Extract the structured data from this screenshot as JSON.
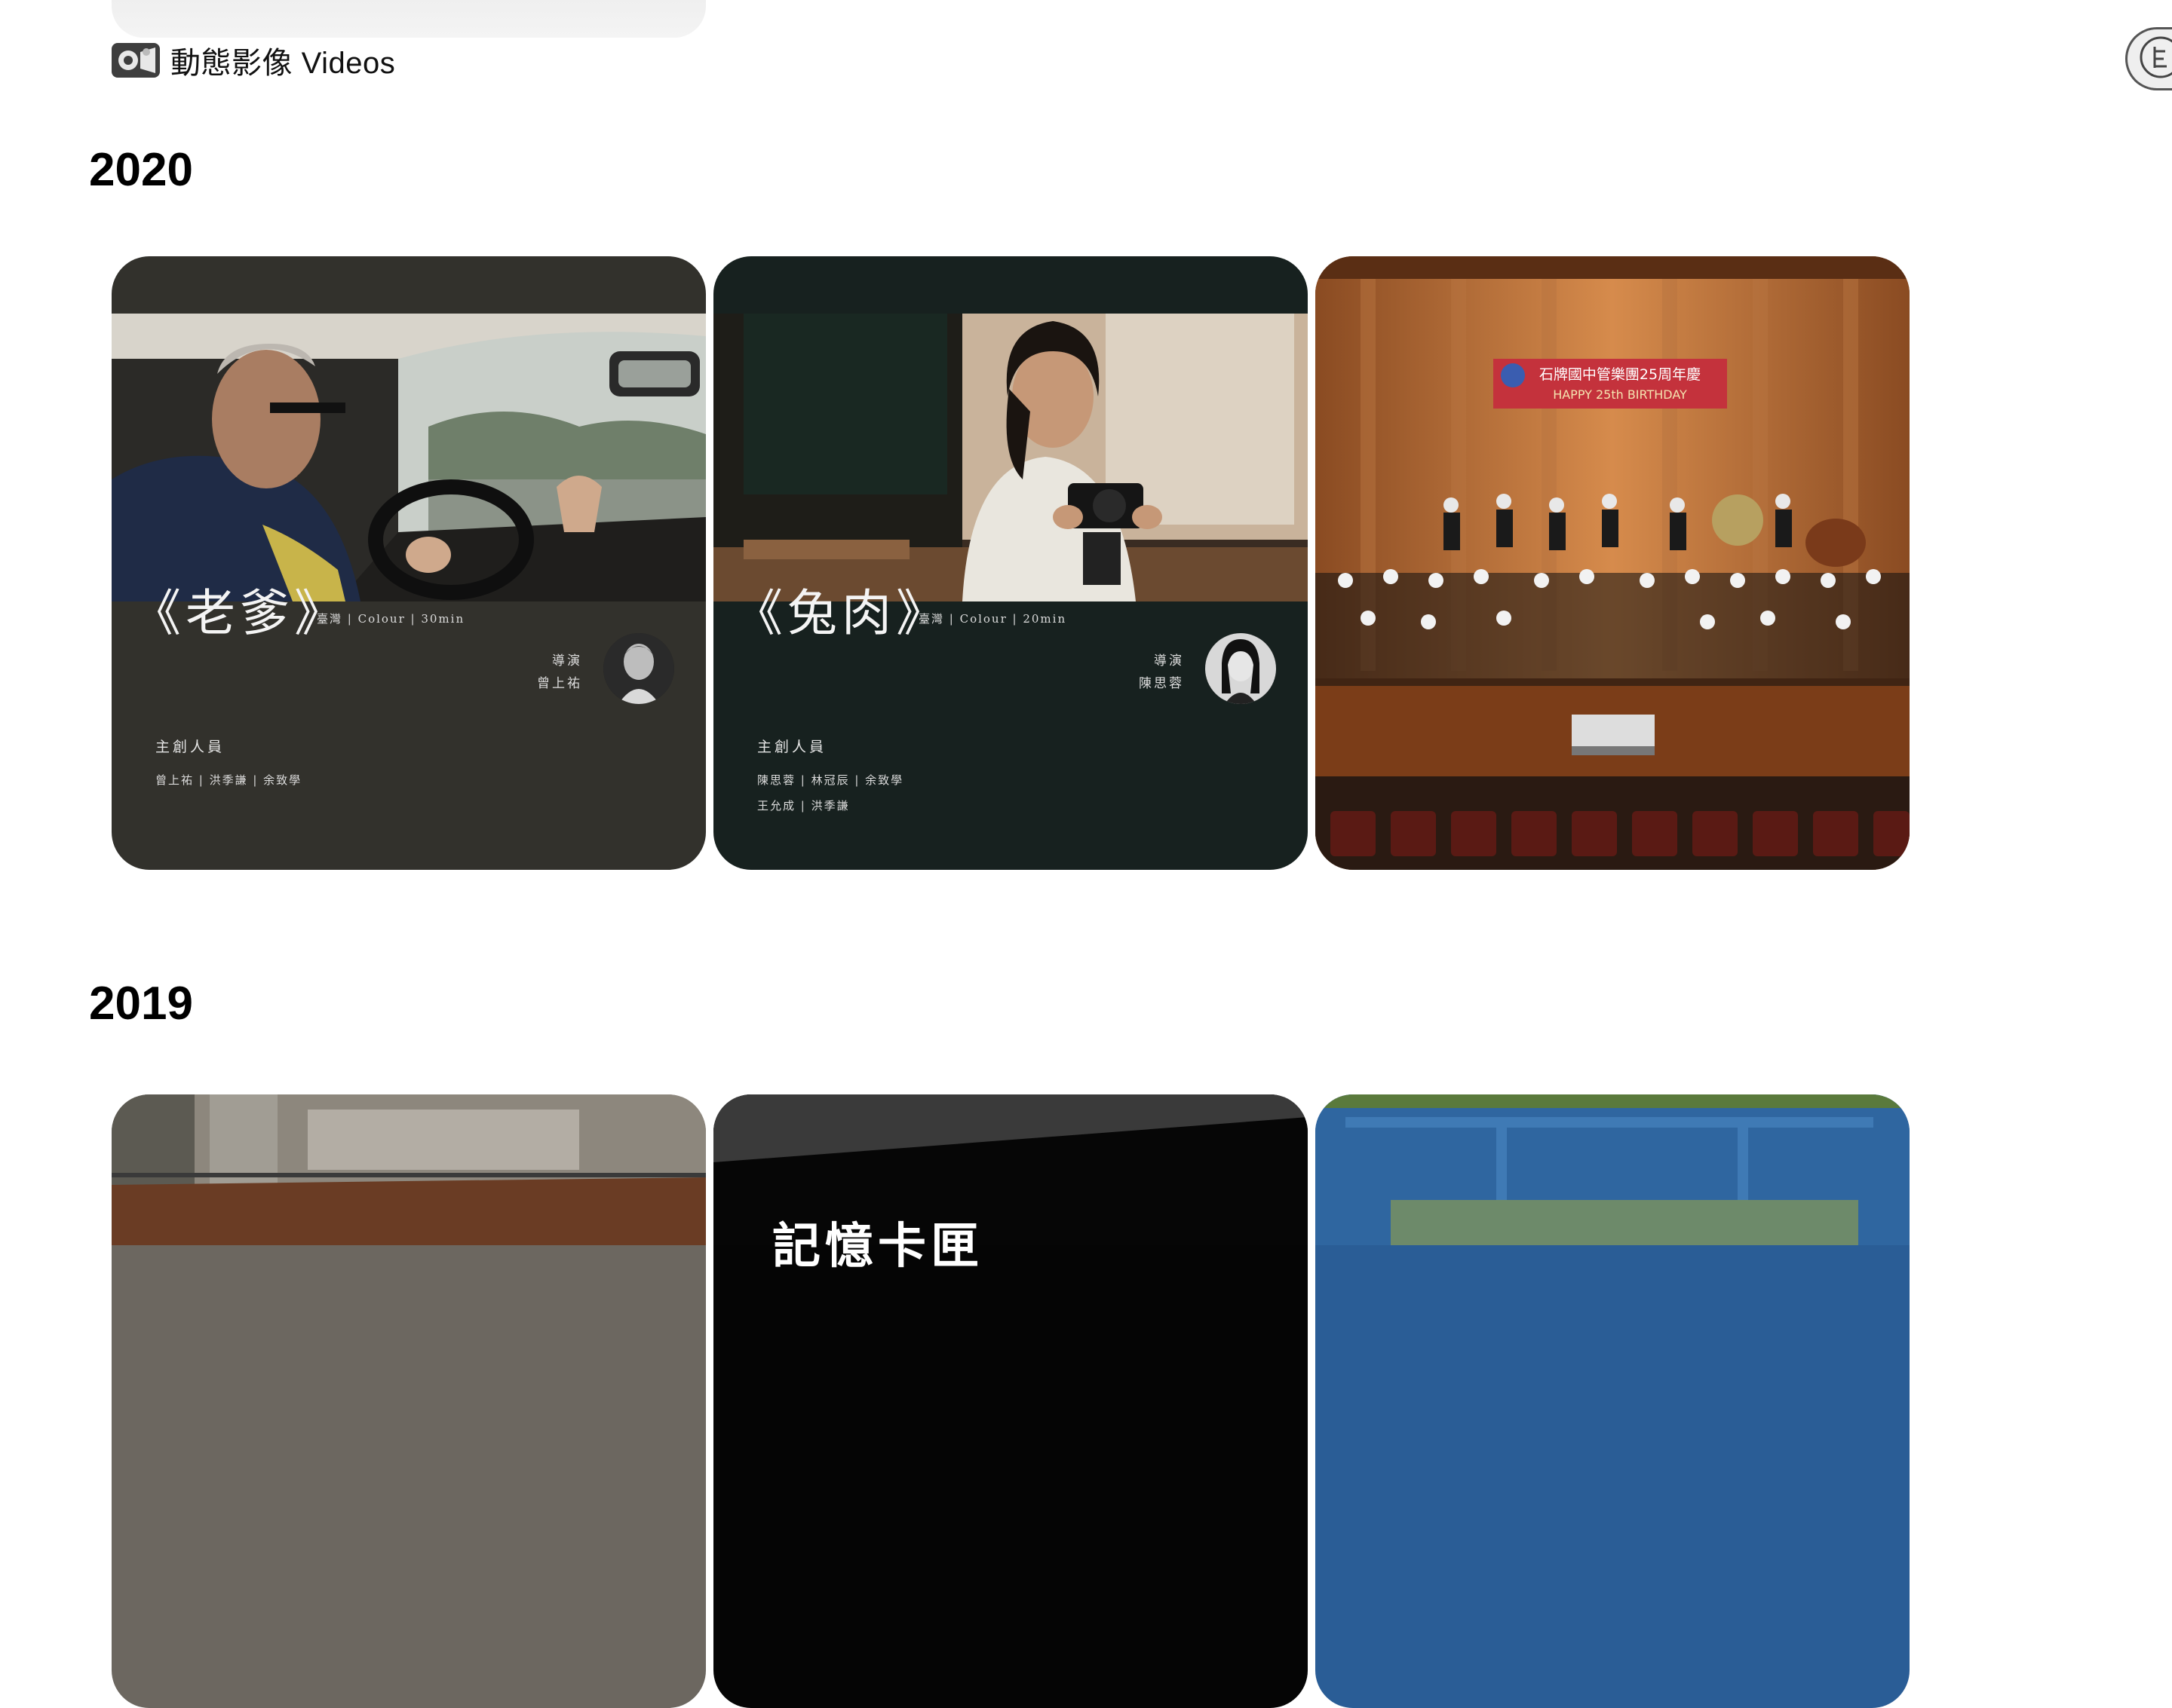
{
  "header": {
    "section_title": "動態影像 Videos",
    "icon": "film-camera-icon"
  },
  "side_button": {
    "icon": "circular-logo-icon"
  },
  "sections": [
    {
      "year": "2020",
      "cards": [
        {
          "title": "《老爹》",
          "meta": "臺灣 | Colour | 30min",
          "director_label": "導演",
          "director_name": "曾上祐",
          "crew_heading": "主創人員",
          "crew_lines": [
            "曾上祐 | 洪季謙 | 余致學"
          ],
          "bg_color": "#32312c"
        },
        {
          "title": "《兔肉》",
          "meta": "臺灣 | Colour | 20min",
          "director_label": "導演",
          "director_name": "陳思蓉",
          "crew_heading": "主創人員",
          "crew_lines": [
            "陳思蓉 | 林冠辰 | 余致學",
            "王允成 | 洪季謙"
          ],
          "bg_color": "#17211f"
        },
        {
          "banner_line1": "石牌國中管樂團25周年慶",
          "banner_line2": "HAPPY 25th BIRTHDAY"
        }
      ]
    },
    {
      "year": "2019",
      "cards": [
        {
          "thumbnail": "street-scene"
        },
        {
          "title": "記憶卡匣"
        },
        {
          "thumbnail": "blue-truck"
        }
      ]
    }
  ]
}
